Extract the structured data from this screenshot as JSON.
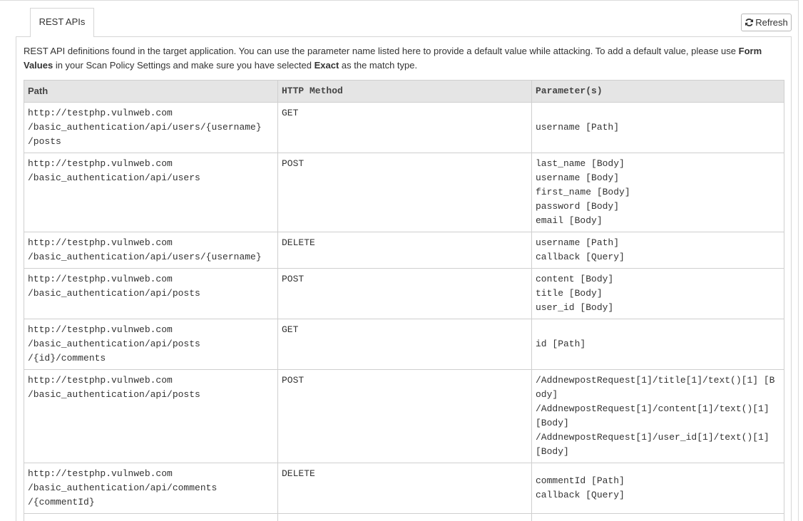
{
  "tabs": [
    {
      "label": "REST APIs"
    }
  ],
  "toolbar": {
    "refresh_label": "Refresh"
  },
  "description": {
    "part1": "REST API definitions found in the target application. You can use the parameter name listed here to provide a default value while attacking. To add a default value, please use ",
    "bold1": "Form Values",
    "part2": " in your Scan Policy Settings and make sure you have selected ",
    "bold2": "Exact",
    "part3": " as the match type."
  },
  "table": {
    "headers": {
      "path": "Path",
      "method": "HTTP Method",
      "params": "Parameter(s)"
    },
    "rows": [
      {
        "path": [
          "http://testphp.vulnweb.com",
          "/basic_authentication/api/users/{username}",
          "/posts"
        ],
        "method": "GET",
        "params": [
          "username [Path]"
        ]
      },
      {
        "path": [
          "http://testphp.vulnweb.com",
          "/basic_authentication/api/users"
        ],
        "method": "POST",
        "params": [
          "last_name [Body]",
          "username [Body]",
          "first_name [Body]",
          "password [Body]",
          "email [Body]"
        ]
      },
      {
        "path": [
          "http://testphp.vulnweb.com",
          "/basic_authentication/api/users/{username}"
        ],
        "method": "DELETE",
        "params": [
          "username [Path]",
          "callback [Query]"
        ]
      },
      {
        "path": [
          "http://testphp.vulnweb.com",
          "/basic_authentication/api/posts"
        ],
        "method": "POST",
        "params": [
          "content [Body]",
          "title [Body]",
          "user_id [Body]"
        ]
      },
      {
        "path": [
          "http://testphp.vulnweb.com",
          "/basic_authentication/api/posts",
          "/{id}/comments"
        ],
        "method": "GET",
        "params": [
          "id [Path]"
        ]
      },
      {
        "path": [
          "http://testphp.vulnweb.com",
          "/basic_authentication/api/posts"
        ],
        "method": "POST",
        "params": [
          "/AddnewpostRequest[1]/title[1]/text()[1] [Body]",
          "/AddnewpostRequest[1]/content[1]/text()[1] [Body]",
          "/AddnewpostRequest[1]/user_id[1]/text()[1] [Body]"
        ]
      },
      {
        "path": [
          "http://testphp.vulnweb.com",
          "/basic_authentication/api/comments",
          "/{commentId}"
        ],
        "method": "DELETE",
        "params": [
          "commentId [Path]",
          "callback [Query]"
        ]
      },
      {
        "path": [
          ""
        ],
        "method": "",
        "params": [
          ""
        ]
      }
    ]
  }
}
